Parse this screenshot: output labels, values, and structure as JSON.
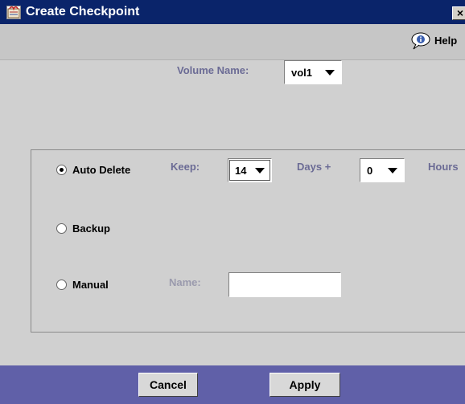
{
  "window": {
    "title": "Create Checkpoint",
    "close_glyph": "×"
  },
  "toolbar": {
    "help_label": "Help",
    "help_icon": "help-speech-bubble-icon"
  },
  "volume": {
    "label": "Volume Name:",
    "selected": "vol1"
  },
  "options": {
    "auto_delete": {
      "label": "Auto Delete",
      "selected": true,
      "keep_label": "Keep:",
      "days_value": "14",
      "days_label": "Days +",
      "hours_value": "0",
      "hours_label": "Hours"
    },
    "backup": {
      "label": "Backup",
      "selected": false
    },
    "manual": {
      "label": "Manual",
      "selected": false,
      "name_label": "Name:",
      "name_value": ""
    }
  },
  "buttons": {
    "cancel": "Cancel",
    "apply": "Apply"
  },
  "colors": {
    "title_bar": "#0a246a",
    "footer": "#6060a8",
    "label_accent": "#6b6b95"
  }
}
